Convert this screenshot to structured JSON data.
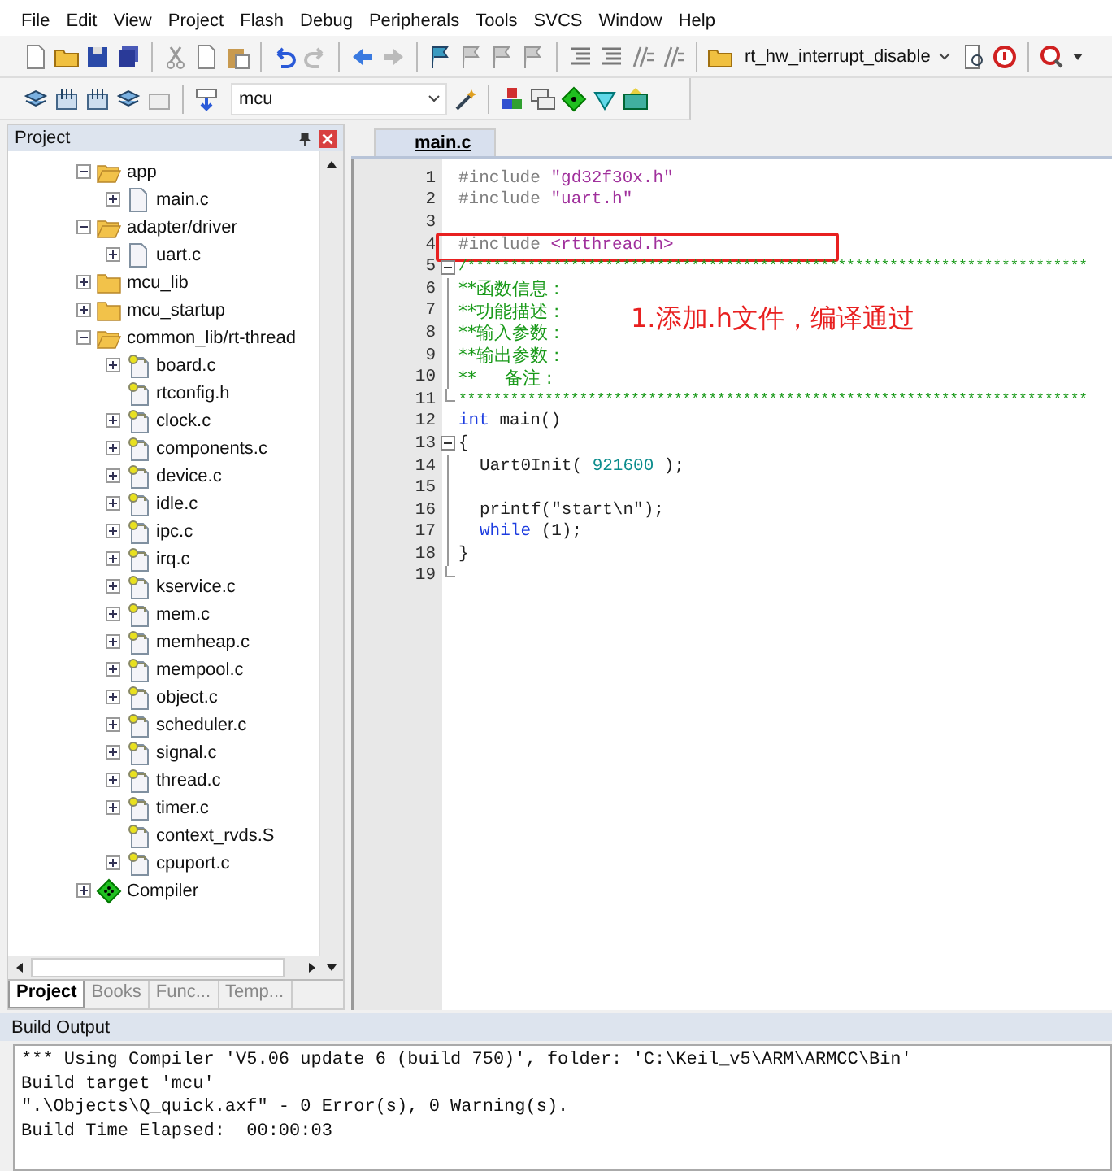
{
  "menu": [
    {
      "label": "File"
    },
    {
      "label": "Edit"
    },
    {
      "label": "View"
    },
    {
      "label": "Project"
    },
    {
      "label": "Flash"
    },
    {
      "label": "Debug"
    },
    {
      "label": "Peripherals"
    },
    {
      "label": "Tools"
    },
    {
      "label": "SVCS"
    },
    {
      "label": "Window"
    },
    {
      "label": "Help"
    }
  ],
  "toolbar": {
    "function_box": {
      "value": "rt_hw_interrupt_disable"
    },
    "target_box": {
      "value": "mcu"
    }
  },
  "project_panel": {
    "title": "Project",
    "tree": [
      {
        "label": "app",
        "kind": "folder",
        "toggle": true,
        "expanded": true,
        "children": [
          {
            "label": "main.c",
            "kind": "file",
            "toggle": true,
            "expanded": false
          }
        ]
      },
      {
        "label": "adapter/driver",
        "kind": "folder",
        "toggle": true,
        "expanded": true,
        "children": [
          {
            "label": "uart.c",
            "kind": "file",
            "toggle": true,
            "expanded": false
          }
        ]
      },
      {
        "label": "mcu_lib",
        "kind": "folder",
        "toggle": true,
        "expanded": false
      },
      {
        "label": "mcu_startup",
        "kind": "folder",
        "toggle": true,
        "expanded": false
      },
      {
        "label": "common_lib/rt-thread",
        "kind": "folder",
        "toggle": true,
        "expanded": true,
        "children": [
          {
            "label": "board.c",
            "kind": "key_file",
            "toggle": true,
            "expanded": false
          },
          {
            "label": "rtconfig.h",
            "kind": "key_file",
            "toggle": false
          },
          {
            "label": "clock.c",
            "kind": "key_file",
            "toggle": true,
            "expanded": false
          },
          {
            "label": "components.c",
            "kind": "key_file",
            "toggle": true,
            "expanded": false
          },
          {
            "label": "device.c",
            "kind": "key_file",
            "toggle": true,
            "expanded": false
          },
          {
            "label": "idle.c",
            "kind": "key_file",
            "toggle": true,
            "expanded": false
          },
          {
            "label": "ipc.c",
            "kind": "key_file",
            "toggle": true,
            "expanded": false
          },
          {
            "label": "irq.c",
            "kind": "key_file",
            "toggle": true,
            "expanded": false
          },
          {
            "label": "kservice.c",
            "kind": "key_file",
            "toggle": true,
            "expanded": false
          },
          {
            "label": "mem.c",
            "kind": "key_file",
            "toggle": true,
            "expanded": false
          },
          {
            "label": "memheap.c",
            "kind": "key_file",
            "toggle": true,
            "expanded": false
          },
          {
            "label": "mempool.c",
            "kind": "key_file",
            "toggle": true,
            "expanded": false
          },
          {
            "label": "object.c",
            "kind": "key_file",
            "toggle": true,
            "expanded": false
          },
          {
            "label": "scheduler.c",
            "kind": "key_file",
            "toggle": true,
            "expanded": false
          },
          {
            "label": "signal.c",
            "kind": "key_file",
            "toggle": true,
            "expanded": false
          },
          {
            "label": "thread.c",
            "kind": "key_file",
            "toggle": true,
            "expanded": false
          },
          {
            "label": "timer.c",
            "kind": "key_file",
            "toggle": true,
            "expanded": false
          },
          {
            "label": "context_rvds.S",
            "kind": "key_file",
            "toggle": false
          },
          {
            "label": "cpuport.c",
            "kind": "key_file",
            "toggle": true,
            "expanded": false
          }
        ]
      },
      {
        "label": "Compiler",
        "kind": "target",
        "toggle": true,
        "expanded": false
      }
    ],
    "tabs": [
      {
        "label": "Project",
        "selected": true
      },
      {
        "label": "Books",
        "selected": false
      },
      {
        "label": "Func...",
        "selected": false
      },
      {
        "label": "Temp...",
        "selected": false
      }
    ]
  },
  "editor": {
    "tabs": [
      {
        "label": "main.c",
        "selected": true
      }
    ],
    "lines": [
      {
        "number": "1",
        "kind": "plain",
        "indented": false,
        "highlighted": false,
        "tokens": [
          {
            "kind": "directive",
            "text": "#include"
          },
          {
            "kind": "string",
            "text": "\"gd32f30x.h\""
          }
        ]
      },
      {
        "number": "2",
        "kind": "plain",
        "indented": false,
        "highlighted": false,
        "tokens": [
          {
            "kind": "directive",
            "text": "#include"
          },
          {
            "kind": "string",
            "text": "\"uart.h\""
          }
        ]
      },
      {
        "number": "3",
        "kind": "plain",
        "highlighted": false
      },
      {
        "number": "4",
        "kind": "plain",
        "indented": false,
        "highlighted": true,
        "tokens": [
          {
            "kind": "directive",
            "text": "#include"
          },
          {
            "kind": "string",
            "text": "<rtthread.h>"
          }
        ]
      },
      {
        "number": "5",
        "kind": "fold_start",
        "indented": false,
        "highlighted": false,
        "tokens": [
          {
            "kind": "stars",
            "text": "/************************************************************************"
          }
        ]
      },
      {
        "number": "6",
        "kind": "fold_body",
        "indented": false,
        "highlighted": false,
        "tokens": [
          {
            "kind": "comment",
            "text": "**函数信息 :"
          }
        ]
      },
      {
        "number": "7",
        "kind": "fold_body",
        "indented": false,
        "highlighted": false,
        "tokens": [
          {
            "kind": "comment",
            "text": "**功能描述 :"
          }
        ]
      },
      {
        "number": "8",
        "kind": "fold_body",
        "indented": false,
        "highlighted": false,
        "tokens": [
          {
            "kind": "comment",
            "text": "**输入参数 :"
          }
        ]
      },
      {
        "number": "9",
        "kind": "fold_body",
        "indented": false,
        "highlighted": false,
        "tokens": [
          {
            "kind": "comment",
            "text": "**输出参数 :"
          }
        ]
      },
      {
        "number": "10",
        "kind": "fold_body",
        "indented": false,
        "highlighted": false,
        "tokens": [
          {
            "kind": "comment",
            "text": "**     备注 :"
          }
        ]
      },
      {
        "number": "11",
        "kind": "fold_end",
        "indented": false,
        "highlighted": false,
        "tokens": [
          {
            "kind": "stars",
            "text": "*************************************************************************"
          }
        ]
      },
      {
        "number": "12",
        "kind": "plain",
        "indented": false,
        "highlighted": false,
        "tokens": [
          {
            "kind": "keyword",
            "text": "int"
          },
          {
            "kind": "plain",
            "text": "main()"
          }
        ]
      },
      {
        "number": "13",
        "kind": "fold_start",
        "indented": false,
        "highlighted": false,
        "tokens": [
          {
            "kind": "plain",
            "text": "{"
          }
        ]
      },
      {
        "number": "14",
        "kind": "fold_body",
        "indented": true,
        "highlighted": false,
        "tokens": [
          {
            "kind": "plain",
            "text": "Uart0Init("
          },
          {
            "kind": "number",
            "text": "921600"
          },
          {
            "kind": "plain",
            "text": ");"
          }
        ]
      },
      {
        "number": "15",
        "kind": "fold_body",
        "highlighted": false
      },
      {
        "number": "16",
        "kind": "fold_body",
        "indented": true,
        "highlighted": false,
        "tokens": [
          {
            "kind": "plain",
            "text": "printf(\"start\\n\");"
          }
        ]
      },
      {
        "number": "17",
        "kind": "fold_body",
        "indented": true,
        "highlighted": false,
        "tokens": [
          {
            "kind": "keyword",
            "text": "while"
          },
          {
            "kind": "plain",
            "text": "(1);"
          }
        ]
      },
      {
        "number": "18",
        "kind": "fold_body",
        "indented": false,
        "highlighted": false,
        "tokens": [
          {
            "kind": "plain",
            "text": "}"
          }
        ]
      },
      {
        "number": "19",
        "kind": "fold_end",
        "highlighted": false
      }
    ],
    "annotation": "1.添加.h文件，编译通过"
  },
  "build_output": {
    "title": "Build Output",
    "lines": [
      "*** Using Compiler 'V5.06 update 6 (build 750)', folder: 'C:\\Keil_v5\\ARM\\ARMCC\\Bin'",
      "Build target 'mcu'",
      "\".\\Objects\\Q_quick.axf\" - 0 Error(s), 0 Warning(s).",
      "Build Time Elapsed:  00:00:03"
    ]
  }
}
